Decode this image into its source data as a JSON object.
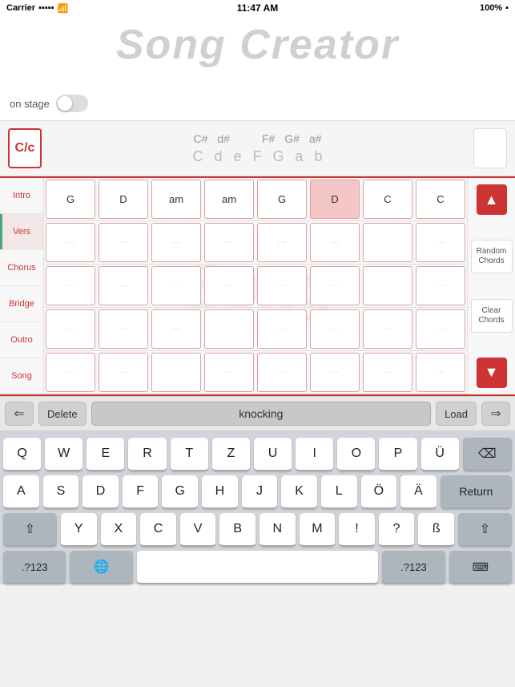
{
  "statusBar": {
    "carrier": "Carrier",
    "time": "11:47 AM",
    "battery": "100%"
  },
  "header": {
    "logo": "Song Creator",
    "onStageLabel": "on stage"
  },
  "keySelector": {
    "ccButton": "C/c",
    "sharps": [
      "C#",
      "d#",
      "",
      "F#",
      "G#",
      "a#"
    ],
    "naturals": [
      "C",
      "d",
      "e",
      "F",
      "G",
      "a",
      "b"
    ]
  },
  "sections": [
    {
      "id": "intro",
      "label": "Intro",
      "active": false
    },
    {
      "id": "vers",
      "label": "Vers",
      "active": true
    },
    {
      "id": "chorus",
      "label": "Chorus",
      "active": false
    },
    {
      "id": "bridge",
      "label": "Bridge",
      "active": false
    },
    {
      "id": "outro",
      "label": "Outro",
      "active": false
    },
    {
      "id": "song",
      "label": "Song",
      "active": false
    }
  ],
  "chordGrid": {
    "rows": [
      [
        "G",
        "D",
        "am",
        "am",
        "G",
        "D",
        "C",
        "C"
      ],
      [
        "...",
        "...",
        "...",
        "...",
        "...",
        "...",
        "",
        "..."
      ],
      [
        "...",
        "...",
        "...",
        "...",
        "...",
        "...",
        "",
        "..."
      ],
      [
        "...",
        "...",
        "...",
        "",
        "...",
        "...",
        "...",
        "..."
      ],
      [
        "...",
        "...",
        "",
        "...",
        "...",
        "...",
        "...",
        "..."
      ]
    ]
  },
  "sidebar": {
    "upArrow": "▲",
    "randomChordsLabel": "Random Chords",
    "clearChordsLabel": "Clear Chords",
    "downArrow": "▼"
  },
  "toolbar": {
    "leftArrow": "←",
    "deleteLabel": "Delete",
    "inputValue": "knocking",
    "loadLabel": "Load",
    "rightArrow": "→"
  },
  "keyboard": {
    "row1": [
      "Q",
      "W",
      "E",
      "R",
      "T",
      "Z",
      "U",
      "I",
      "O",
      "P",
      "Ü"
    ],
    "row2": [
      "A",
      "S",
      "D",
      "F",
      "G",
      "H",
      "J",
      "K",
      "L",
      "Ö",
      "Ä"
    ],
    "row3": [
      "Y",
      "X",
      "C",
      "V",
      "B",
      "N",
      "M",
      "!",
      "?",
      "ß"
    ],
    "deleteLabel": "⌫",
    "returnLabel": "Return",
    "shiftLabel": "⇧",
    "symLabel": ".?123",
    "globeLabel": "🌐",
    "spaceLabel": "",
    "symLabel2": ".?123",
    "kbIconLabel": "⌨"
  },
  "watermark": "Song"
}
